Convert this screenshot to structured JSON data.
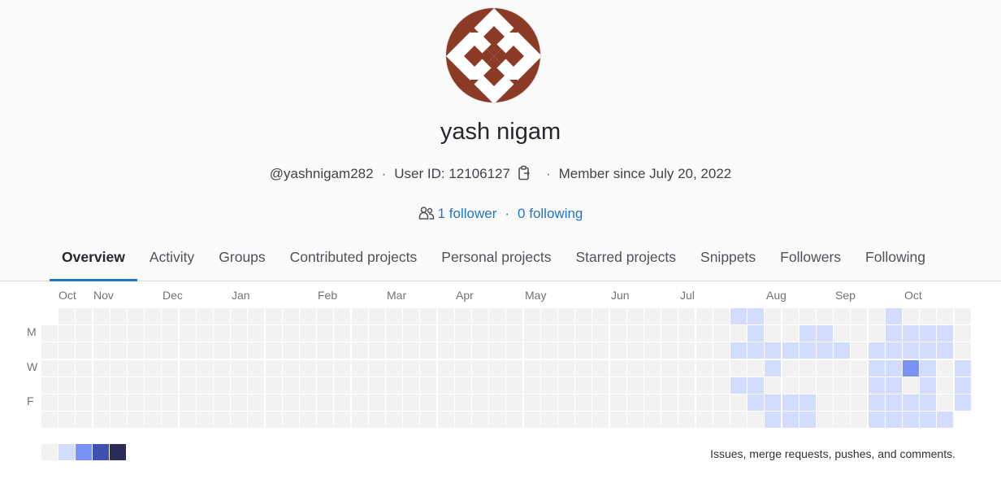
{
  "profile": {
    "name": "yash nigam",
    "username": "@yashnigam282",
    "user_id_text": "User ID: 12106127",
    "member_since": "Member since July 20, 2022",
    "followers_text": "1 follower",
    "following_text": "0 following",
    "copy_icon": "clipboard-icon",
    "people_icon": "users-icon"
  },
  "tabs": [
    {
      "label": "Overview",
      "active": true
    },
    {
      "label": "Activity"
    },
    {
      "label": "Groups"
    },
    {
      "label": "Contributed projects"
    },
    {
      "label": "Personal projects"
    },
    {
      "label": "Starred projects"
    },
    {
      "label": "Snippets"
    },
    {
      "label": "Followers"
    },
    {
      "label": "Following"
    }
  ],
  "calendar": {
    "months": [
      "Oct",
      "Nov",
      "Dec",
      "Jan",
      "Feb",
      "Mar",
      "Apr",
      "May",
      "Jun",
      "Jul",
      "Aug",
      "Sep",
      "Oct"
    ],
    "day_labels": [
      "M",
      "W",
      "F"
    ],
    "legend_text": "Issues, merge requests, pushes, and comments.",
    "level_colors": [
      "#f2f2f2",
      "#d2dcff",
      "#7992f5",
      "#3f51ae",
      "#2a2b59"
    ],
    "weeks": 53,
    "active_cells": [
      [
        40,
        1,
        1
      ],
      [
        40,
        2,
        0
      ],
      [
        40,
        3,
        1
      ],
      [
        40,
        4,
        0
      ],
      [
        40,
        5,
        1
      ],
      [
        40,
        6,
        0
      ],
      [
        41,
        1,
        1
      ],
      [
        41,
        2,
        1
      ],
      [
        41,
        3,
        1
      ],
      [
        41,
        4,
        0
      ],
      [
        41,
        5,
        1
      ],
      [
        41,
        6,
        1
      ],
      [
        42,
        3,
        1
      ],
      [
        42,
        4,
        1
      ],
      [
        42,
        5,
        0
      ],
      [
        42,
        6,
        1
      ],
      [
        42,
        7,
        1
      ],
      [
        43,
        3,
        1
      ],
      [
        43,
        6,
        1
      ],
      [
        43,
        7,
        1
      ],
      [
        44,
        2,
        1
      ],
      [
        44,
        3,
        1
      ],
      [
        44,
        6,
        1
      ],
      [
        44,
        7,
        1
      ],
      [
        45,
        2,
        1
      ],
      [
        45,
        3,
        1
      ],
      [
        46,
        3,
        1
      ],
      [
        48,
        3,
        1
      ],
      [
        48,
        4,
        1
      ],
      [
        48,
        5,
        1
      ],
      [
        48,
        6,
        1
      ],
      [
        48,
        7,
        1
      ],
      [
        49,
        1,
        1
      ],
      [
        49,
        2,
        1
      ],
      [
        49,
        3,
        1
      ],
      [
        49,
        4,
        1
      ],
      [
        49,
        5,
        1
      ],
      [
        49,
        6,
        1
      ],
      [
        49,
        7,
        1
      ],
      [
        50,
        2,
        1
      ],
      [
        50,
        3,
        1
      ],
      [
        50,
        4,
        2
      ],
      [
        50,
        6,
        1
      ],
      [
        50,
        7,
        1
      ],
      [
        51,
        2,
        1
      ],
      [
        51,
        3,
        1
      ],
      [
        51,
        4,
        1
      ],
      [
        51,
        5,
        1
      ],
      [
        51,
        6,
        1
      ],
      [
        51,
        7,
        1
      ],
      [
        52,
        2,
        1
      ],
      [
        52,
        3,
        1
      ],
      [
        52,
        7,
        1
      ],
      [
        53,
        4,
        1
      ],
      [
        53,
        5,
        1
      ],
      [
        53,
        6,
        1
      ]
    ]
  }
}
